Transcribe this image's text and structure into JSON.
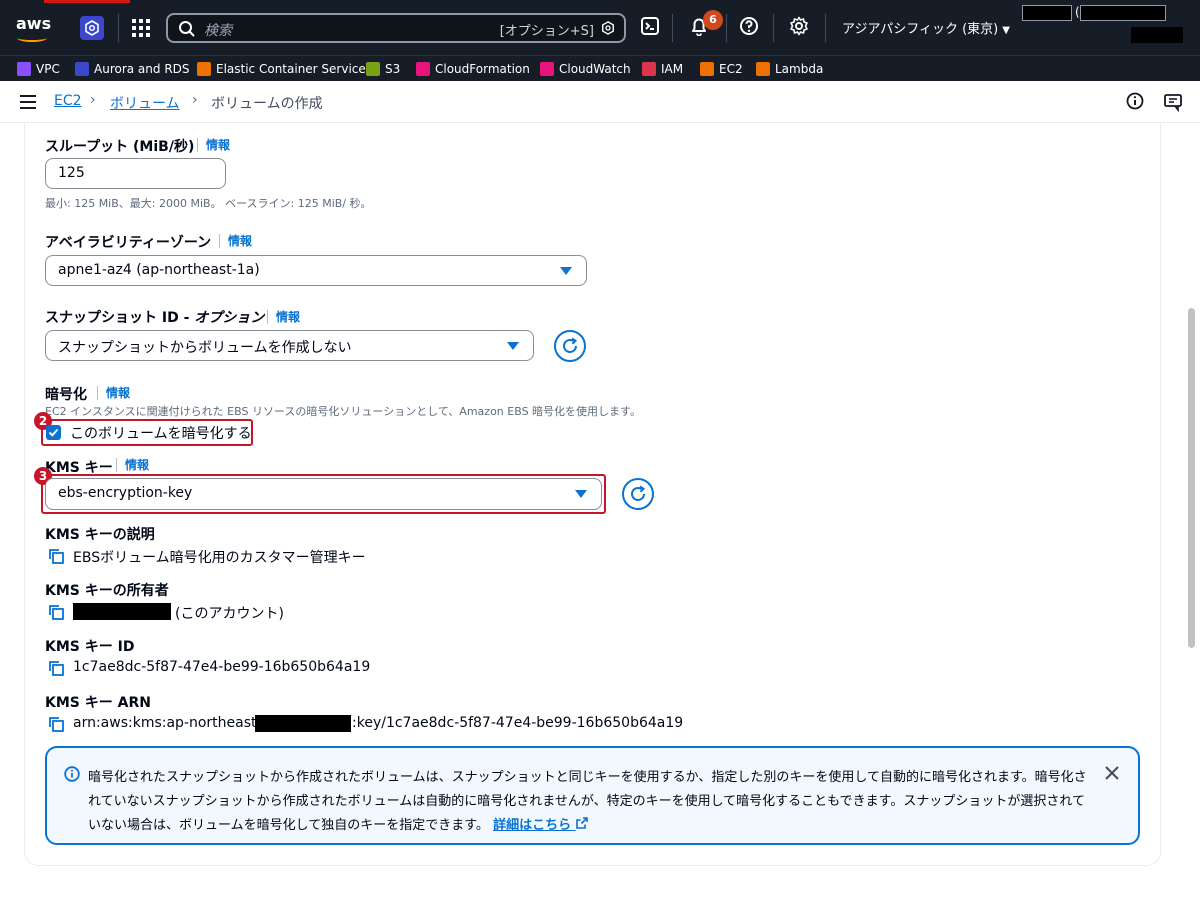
{
  "topbar": {
    "search_placeholder": "検索",
    "search_shortcut": "[オプション+S]",
    "notification_count": "6",
    "region": "アジアパシフィック (東京)",
    "account_paren": "("
  },
  "favorites": [
    {
      "label": "VPC",
      "color": "#8c4fff"
    },
    {
      "label": "Aurora and RDS",
      "color": "#3b48cc"
    },
    {
      "label": "Elastic Container Service",
      "color": "#ed7100"
    },
    {
      "label": "S3",
      "color": "#7aa116"
    },
    {
      "label": "CloudFormation",
      "color": "#e7157b"
    },
    {
      "label": "CloudWatch",
      "color": "#e7157b"
    },
    {
      "label": "IAM",
      "color": "#dd344c"
    },
    {
      "label": "EC2",
      "color": "#ed7100"
    },
    {
      "label": "Lambda",
      "color": "#ed7100"
    }
  ],
  "breadcrumb": {
    "item1": "EC2",
    "item2": "ボリューム",
    "current": "ボリュームの作成"
  },
  "form": {
    "throughput": {
      "label": "スループット (MiB/秒)",
      "info": "情報",
      "value": "125",
      "hint": "最小: 125 MiB、最大: 2000 MiB。 ベースライン: 125 MiB/ 秒。"
    },
    "az": {
      "label": "アベイラビリティーゾーン",
      "info": "情報",
      "value": "apne1-az4 (ap-northeast-1a)"
    },
    "snapshot": {
      "label_main": "スナップショット ID - ",
      "label_italic": "オプション",
      "info": "情報",
      "value": "スナップショットからボリュームを作成しない"
    },
    "encryption": {
      "label": "暗号化",
      "info": "情報",
      "desc": "EC2 インスタンスに関連付けられた EBS リソースの暗号化ソリューションとして、Amazon EBS 暗号化を使用します。",
      "checkbox_label": "このボリュームを暗号化する",
      "checked": true,
      "step": "2"
    },
    "kms_key": {
      "label": "KMS キー",
      "info": "情報",
      "value": "ebs-encryption-key",
      "step": "3"
    },
    "kms_desc": {
      "label": "KMS キーの説明",
      "value": "EBSボリューム暗号化用のカスタマー管理キー"
    },
    "kms_owner": {
      "label": "KMS キーの所有者",
      "suffix": "(このアカウント)"
    },
    "kms_id": {
      "label": "KMS キー ID",
      "value": "1c7ae8dc-5f87-47e4-be99-16b650b64a19"
    },
    "kms_arn": {
      "label": "KMS キー ARN",
      "prefix": "arn:aws:kms:ap-northeast-1:",
      "suffix": ":key/1c7ae8dc-5f87-47e4-be99-16b650b64a19"
    }
  },
  "alert": {
    "text": "暗号化されたスナップショットから作成されたボリュームは、スナップショットと同じキーを使用するか、指定した別のキーを使用して自動的に暗号化されます。暗号化されていないスナップショットから作成されたボリュームは自動的に暗号化されませんが、特定のキーを使用して暗号化することもできます。スナップショットが選択されていない場合は、ボリュームを暗号化して独自のキーを指定できます。",
    "link": "詳細はこちら"
  },
  "colors": {
    "link": "#0972d3",
    "highlight": "#c7162b",
    "topbar": "#161d26"
  }
}
